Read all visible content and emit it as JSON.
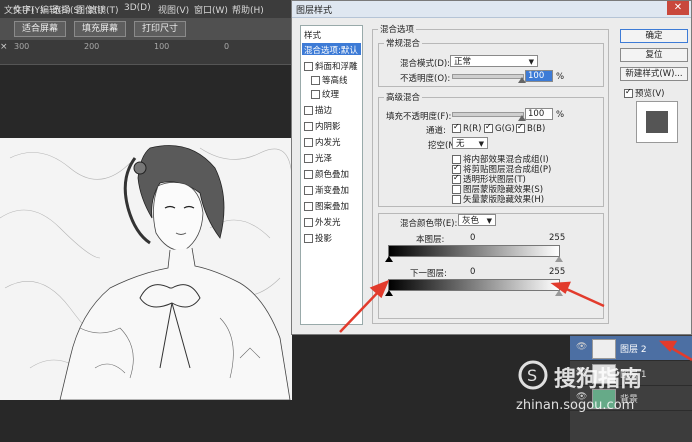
{
  "menubar": {
    "items": [
      "文件(F)",
      "编辑(E)",
      "图像(I)",
      "文字(Y)",
      "选择(S)",
      "滤镜(T)",
      "3D(D)",
      "视图(V)",
      "窗口(W)",
      "帮助(H)"
    ]
  },
  "options_bar": {
    "buttons": [
      "适合屏幕",
      "填充屏幕",
      "打印尺寸"
    ]
  },
  "ruler": {
    "ticks": [
      "300",
      "200",
      "100",
      "0"
    ]
  },
  "tab_close": "×",
  "dialog": {
    "title": "图层样式",
    "style_list_header": "样式",
    "style_items": [
      {
        "label": "混合选项:默认",
        "checkbox": false,
        "selected": true
      },
      {
        "label": "斜面和浮雕",
        "checkbox": true,
        "checked": false
      },
      {
        "label": "等高线",
        "checkbox": true,
        "checked": false,
        "indent": true
      },
      {
        "label": "纹理",
        "checkbox": true,
        "checked": false,
        "indent": true
      },
      {
        "label": "描边",
        "checkbox": true,
        "checked": false
      },
      {
        "label": "内阴影",
        "checkbox": true,
        "checked": false
      },
      {
        "label": "内发光",
        "checkbox": true,
        "checked": false
      },
      {
        "label": "光泽",
        "checkbox": true,
        "checked": false
      },
      {
        "label": "颜色叠加",
        "checkbox": true,
        "checked": false
      },
      {
        "label": "渐变叠加",
        "checkbox": true,
        "checked": false
      },
      {
        "label": "图案叠加",
        "checkbox": true,
        "checked": false
      },
      {
        "label": "外发光",
        "checkbox": true,
        "checked": false
      },
      {
        "label": "投影",
        "checkbox": true,
        "checked": false
      }
    ],
    "blending_options_title": "混合选项",
    "general_blending": {
      "title": "常规混合",
      "mode_label": "混合模式(D):",
      "mode_value": "正常",
      "opacity_label": "不透明度(O):",
      "opacity_value": "100",
      "percent": "%",
      "opacity_level": 1.0
    },
    "advanced_blending": {
      "title": "高级混合",
      "fill_opacity_label": "填充不透明度(F):",
      "fill_opacity_value": "100",
      "percent": "%",
      "fill_level": 1.0,
      "channels_label": "通道:",
      "channels": [
        {
          "label": "R(R)",
          "checked": true
        },
        {
          "label": "G(G)",
          "checked": true
        },
        {
          "label": "B(B)",
          "checked": true
        }
      ],
      "knockout_label": "挖空(N):",
      "knockout_value": "无",
      "options": [
        {
          "label": "将内部效果混合成组(I)",
          "checked": false
        },
        {
          "label": "将剪贴图层混合成组(P)",
          "checked": true
        },
        {
          "label": "透明形状图层(T)",
          "checked": true
        },
        {
          "label": "图层蒙版隐藏效果(S)",
          "checked": false
        },
        {
          "label": "矢量蒙版隐藏效果(H)",
          "checked": false
        }
      ]
    },
    "blend_if": {
      "label": "混合颜色带(E):",
      "value": "灰色",
      "this_layer_label": "本图层:",
      "this_layer_min": "0",
      "this_layer_max": "255",
      "underlying_label": "下一图层:",
      "underlying_min": "0",
      "underlying_max": "255"
    },
    "buttons": {
      "ok": "确定",
      "reset": "复位",
      "new_style": "新建样式(W)...",
      "preview": "预览(V)",
      "preview_checked": true
    }
  },
  "layers": [
    {
      "name": "图层 2",
      "selected": true
    },
    {
      "name": "图层 1",
      "selected": false
    },
    {
      "name": "背景",
      "selected": false
    }
  ],
  "watermark": {
    "brand": "搜狗指南",
    "url": "zhinan.sogou.com"
  },
  "colors": {
    "selection_blue": "#3d7bd6",
    "annotation_red": "#e23b2c",
    "dialog_bg": "#ececec"
  }
}
